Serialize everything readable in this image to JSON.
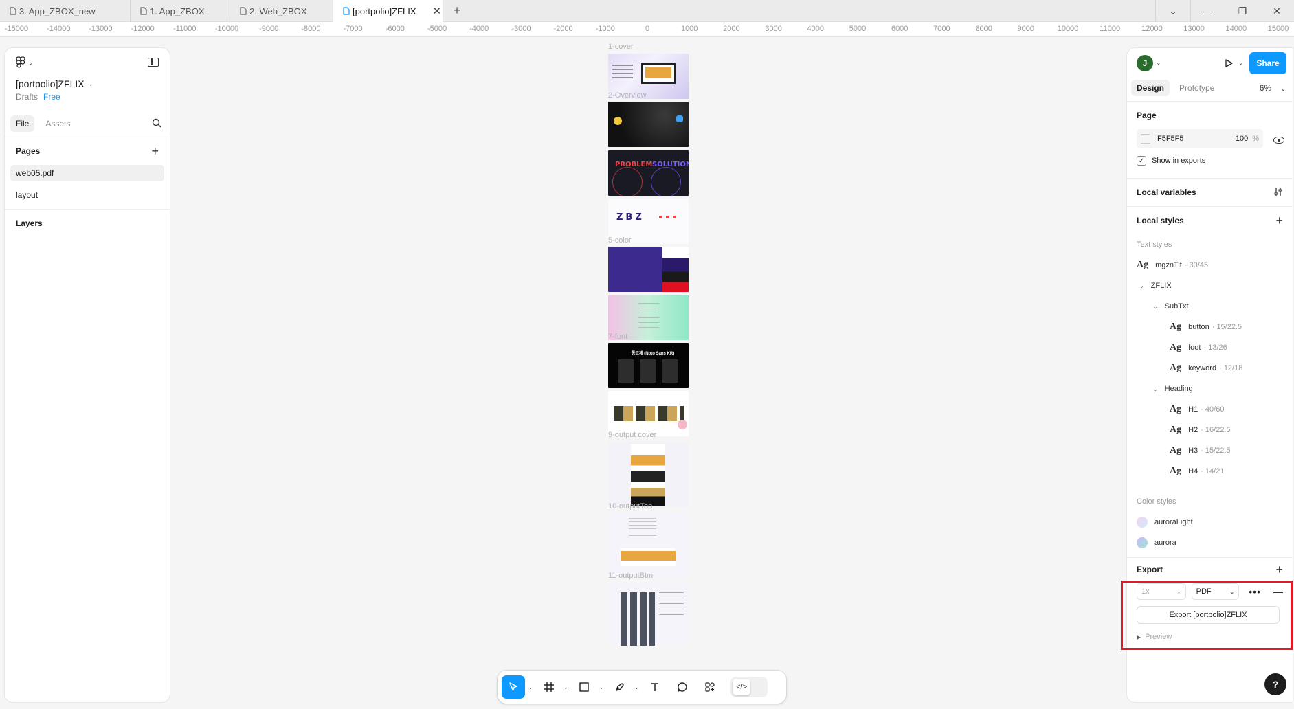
{
  "tabs": [
    {
      "label": "3. App_ZBOX_new",
      "active": false
    },
    {
      "label": "1. App_ZBOX",
      "active": false
    },
    {
      "label": "2. Web_ZBOX",
      "active": false
    },
    {
      "label": "[portpolio]ZFLIX",
      "active": true
    }
  ],
  "ruler_ticks": [
    "-15000",
    "-14000",
    "-13000",
    "-12000",
    "-11000",
    "-10000",
    "-9000",
    "-8000",
    "-7000",
    "-6000",
    "-5000",
    "-4000",
    "-3000",
    "-2000",
    "-1000",
    "0",
    "1000",
    "2000",
    "3000",
    "4000",
    "5000",
    "6000",
    "7000",
    "8000",
    "9000",
    "10000",
    "11000",
    "12000",
    "13000",
    "14000",
    "15000"
  ],
  "left_panel": {
    "file_name": "[portpolio]ZFLIX",
    "location": "Drafts",
    "plan": "Free",
    "tab_file": "File",
    "tab_assets": "Assets",
    "pages_title": "Pages",
    "pages": [
      "web05.pdf",
      "layout"
    ],
    "layers_title": "Layers"
  },
  "frames": {
    "f1": "1-cover",
    "f2": "2-Overview",
    "f5": "5-color",
    "f7": "7-font",
    "f9": "9-output cover",
    "f10": "10-outputTop",
    "f11": "11-outputBtm",
    "f3_t1": "PROBLEM",
    "f3_t2": "SOLUTION",
    "f4_logo": "ZBZ",
    "f7_head": "통고체 (Noto Sans KR)"
  },
  "right_panel": {
    "avatar": "J",
    "share": "Share",
    "tab_design": "Design",
    "tab_prototype": "Prototype",
    "zoom": "6%",
    "page_title": "Page",
    "page_color": "F5F5F5",
    "page_opacity": "100",
    "percent": "%",
    "show_in_exports": "Show in exports",
    "local_variables": "Local variables",
    "local_styles": "Local styles",
    "text_styles": "Text styles",
    "styles": {
      "mgzn": {
        "name": "mgznTit",
        "meta": "· 30/45"
      },
      "zflix": "ZFLIX",
      "subtxt": "SubTxt",
      "button": {
        "name": "button",
        "meta": "· 15/22.5"
      },
      "foot": {
        "name": "foot",
        "meta": "· 13/26"
      },
      "keyword": {
        "name": "keyword",
        "meta": "· 12/18"
      },
      "heading": "Heading",
      "h1": {
        "name": "H1",
        "meta": "· 40/60"
      },
      "h2": {
        "name": "H2",
        "meta": "· 16/22.5"
      },
      "h3": {
        "name": "H3",
        "meta": "· 15/22.5"
      },
      "h4": {
        "name": "H4",
        "meta": "· 14/21"
      }
    },
    "ag": "Ag",
    "color_styles": "Color styles",
    "colors": [
      {
        "name": "auroraLight",
        "color": "#e6dcf5"
      },
      {
        "name": "aurora",
        "color": "#a8d8f0"
      }
    ],
    "export_title": "Export",
    "export_scale": "1x",
    "export_format": "PDF",
    "export_button": "Export [portpolio]ZFLIX",
    "preview": "Preview"
  },
  "help": "?",
  "accent": "#0d99ff",
  "highlight": "#e01a22"
}
